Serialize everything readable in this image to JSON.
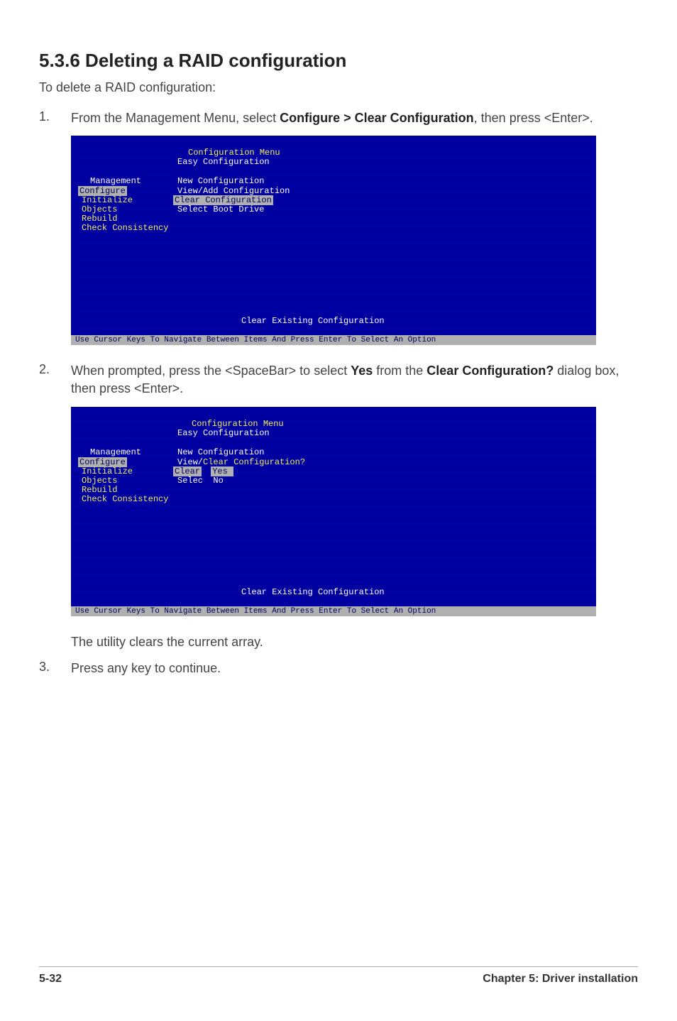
{
  "heading": "5.3.6    Deleting a RAID configuration",
  "intro": "To delete a RAID configuration:",
  "steps": [
    {
      "num": "1.",
      "parts": [
        {
          "t": "From the Management Menu, select ",
          "b": false
        },
        {
          "t": "Configure > Clear Configuration",
          "b": true
        },
        {
          "t": ", then press <Enter>.",
          "b": false
        }
      ]
    },
    {
      "num": "2.",
      "parts": [
        {
          "t": "When prompted, press the <SpaceBar> to select ",
          "b": false
        },
        {
          "t": "Yes",
          "b": true
        },
        {
          "t": " from the ",
          "b": false
        },
        {
          "t": "Clear Configuration?",
          "b": true
        },
        {
          "t": " dialog box, then press <Enter>.",
          "b": false
        }
      ]
    }
  ],
  "shot1": {
    "conf_menu_title": "Configuration Menu",
    "mgmt_label": "Management",
    "mgmt_items": [
      "Configure",
      "Initialize",
      "Objects",
      "Rebuild",
      "Check Consistency"
    ],
    "conf_items": [
      "Easy Configuration",
      "New Configuration",
      "View/Add Configuration",
      "Clear Configuration",
      "Select Boot Drive"
    ],
    "sel_index": 3,
    "banner": "Clear Existing Configuration",
    "footer": "Use Cursor Keys To Navigate Between Items And Press Enter To Select An Option"
  },
  "shot2": {
    "conf_menu_title": "Configuration Menu",
    "mgmt_label": "Management",
    "mgmt_items": [
      "Configure",
      "Initialize",
      "Objects",
      "Rebuild",
      "Check Consistency"
    ],
    "conf_items_pre": [
      "Easy Configuration",
      "New Configuration"
    ],
    "view_prefix": "View/",
    "dialog_title": "Clear Configuration?",
    "clear_label": "Clear",
    "selec_label": "Selec",
    "yes": "Yes",
    "no": "No",
    "banner": "Clear Existing Configuration",
    "footer": "Use Cursor Keys To Navigate Between Items And Press Enter To Select An Option"
  },
  "post_shot2_text": "The utility clears the current array.",
  "step3": {
    "num": "3.",
    "text": "Press any key to continue."
  },
  "footer_left": "5-32",
  "footer_right": "Chapter 5: Driver installation"
}
